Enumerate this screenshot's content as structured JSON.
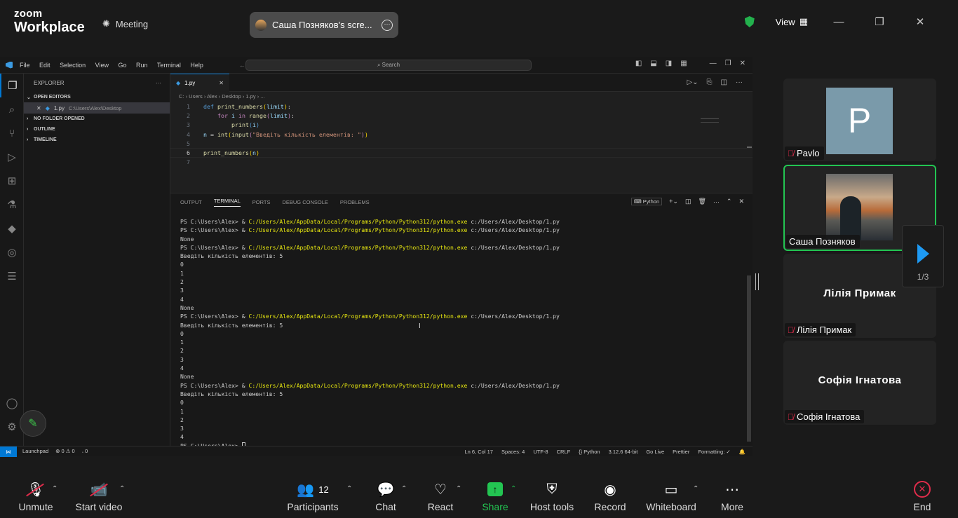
{
  "zoom": {
    "brand_top": "zoom",
    "brand_bottom": "Workplace",
    "meeting_label": "Meeting",
    "share_pill": "Саша Позняков's scre...",
    "view_label": "View"
  },
  "vscode": {
    "menu": [
      "File",
      "Edit",
      "Selection",
      "View",
      "Go",
      "Run",
      "Terminal",
      "Help"
    ],
    "search": "Search",
    "explorer_title": "EXPLORER",
    "open_editors": "OPEN EDITORS",
    "open_file": "1.py",
    "open_file_path": "C:\\Users\\Alex\\Desktop",
    "no_folder": "NO FOLDER OPENED",
    "outline": "OUTLINE",
    "timeline": "TIMELINE",
    "tab": "1.py",
    "breadcrumb": "C: › Users › Alex › Desktop › 1.py › ...",
    "panel_tabs": [
      "OUTPUT",
      "TERMINAL",
      "PORTS",
      "DEBUG CONSOLE",
      "PROBLEMS"
    ],
    "terminal_profile": "Python",
    "status_left": [
      "Launchpad",
      "⊗ 0 ⚠ 0",
      "𝆹 0"
    ],
    "status_right": [
      "Ln 6, Col 17",
      "Spaces: 4",
      "UTF-8",
      "CRLF",
      "{} Python",
      "3.12.6 64-bit",
      "Go Live",
      "Prettier",
      "Formatting: ✓"
    ]
  },
  "terminal_lines": [
    {
      "p": "PS C:\\Users\\Alex> & ",
      "y": "C:/Users/Alex/AppData/Local/Programs/Python/Python312/python.exe",
      "r": " c:/Users/Alex/Desktop/1.py"
    },
    {
      "p": "PS C:\\Users\\Alex> & ",
      "y": "C:/Users/Alex/AppData/Local/Programs/Python/Python312/python.exe",
      "r": " c:/Users/Alex/Desktop/1.py"
    },
    {
      "p": "None",
      "y": "",
      "r": ""
    },
    {
      "p": "PS C:\\Users\\Alex> & ",
      "y": "C:/Users/Alex/AppData/Local/Programs/Python/Python312/python.exe",
      "r": " c:/Users/Alex/Desktop/1.py"
    },
    {
      "p": "Введіть кількість елементів: 5",
      "y": "",
      "r": ""
    },
    {
      "p": "0",
      "y": "",
      "r": ""
    },
    {
      "p": "1",
      "y": "",
      "r": ""
    },
    {
      "p": "2",
      "y": "",
      "r": ""
    },
    {
      "p": "3",
      "y": "",
      "r": ""
    },
    {
      "p": "4",
      "y": "",
      "r": ""
    },
    {
      "p": "None",
      "y": "",
      "r": ""
    },
    {
      "p": "PS C:\\Users\\Alex> & ",
      "y": "C:/Users/Alex/AppData/Local/Programs/Python/Python312/python.exe",
      "r": " c:/Users/Alex/Desktop/1.py"
    },
    {
      "p": "Введіть кількість елементів: 5",
      "y": "",
      "r": ""
    },
    {
      "p": "0",
      "y": "",
      "r": ""
    },
    {
      "p": "1",
      "y": "",
      "r": ""
    },
    {
      "p": "2",
      "y": "",
      "r": ""
    },
    {
      "p": "3",
      "y": "",
      "r": ""
    },
    {
      "p": "4",
      "y": "",
      "r": ""
    },
    {
      "p": "None",
      "y": "",
      "r": ""
    },
    {
      "p": "PS C:\\Users\\Alex> & ",
      "y": "C:/Users/Alex/AppData/Local/Programs/Python/Python312/python.exe",
      "r": " c:/Users/Alex/Desktop/1.py"
    },
    {
      "p": "Введіть кількість елементів: 5",
      "y": "",
      "r": ""
    },
    {
      "p": "0",
      "y": "",
      "r": ""
    },
    {
      "p": "1",
      "y": "",
      "r": ""
    },
    {
      "p": "2",
      "y": "",
      "r": ""
    },
    {
      "p": "3",
      "y": "",
      "r": ""
    },
    {
      "p": "4",
      "y": "",
      "r": ""
    },
    {
      "p": "PS C:\\Users\\Alex> ",
      "y": "",
      "r": ""
    }
  ],
  "participants": {
    "tiles": [
      {
        "name": "Pavlo",
        "initial": "P"
      },
      {
        "name": "Саша Позняков"
      },
      {
        "name": "Лілія Примак",
        "center": "Лілія Примак"
      },
      {
        "name": "Софія Ігнатова",
        "center": "Софія Ігнатова"
      }
    ],
    "page": "1/3"
  },
  "toolbar": {
    "unmute": "Unmute",
    "start_video": "Start video",
    "participants": "Participants",
    "participant_count": "12",
    "chat": "Chat",
    "react": "React",
    "share": "Share",
    "host_tools": "Host tools",
    "record": "Record",
    "whiteboard": "Whiteboard",
    "more": "More",
    "end": "End"
  }
}
